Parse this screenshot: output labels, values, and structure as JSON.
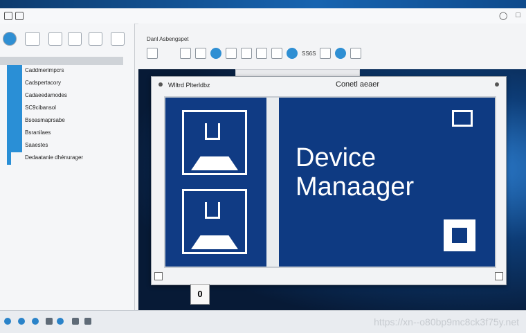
{
  "left_pane": {
    "header": "",
    "tree": [
      "Caddmerimpcrs",
      "Cadspertacory",
      "Cadaeedamodes",
      "SC9cibansol",
      "Bsoasmaprsabe",
      "Bsranilaes",
      "Saaestes",
      "Dedaatanie dhénurager"
    ]
  },
  "right_pane": {
    "title": "Danl Asbengspet",
    "toolbar_text": "SS6S"
  },
  "dialog": {
    "title_left": "Wlltrd Plterldbz",
    "title_center": "Conetl aeaer",
    "main_label": "Device\nManaager"
  },
  "badge": "0",
  "watermark": "https://xn--o80bp9mc8ck3f75y.net",
  "colors": {
    "accent": "#2a8fd6",
    "panel_blue": "#0e3a82"
  }
}
